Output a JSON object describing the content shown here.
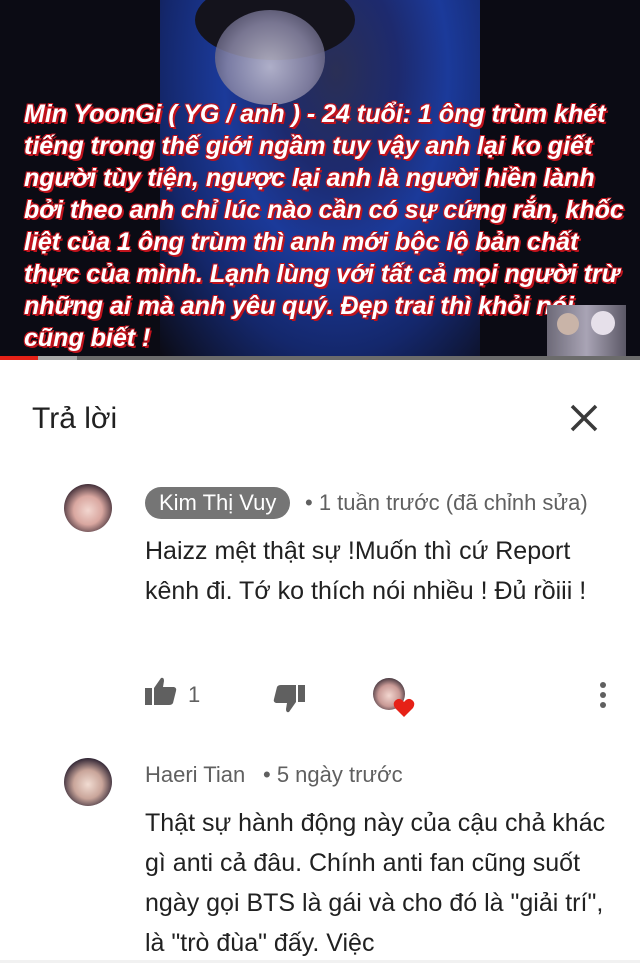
{
  "video": {
    "caption": "Min YoonGi ( YG / anh ) - 24 tuổi: 1 ông trùm khét tiếng trong thế giới ngầm tuy vậy anh lại ko giết người tùy tiện, ngược lại anh là người hiền lành bởi theo anh chỉ lúc nào cần có sự cứng rắn, khốc liệt của 1 ông trùm thì anh mới bộc lộ bản chất thực của mình. Lạnh lùng với tất cả mọi người trừ những ai mà anh yêu quý. Đẹp trai thì khỏi nói cũng biết !",
    "progress_percent": 6,
    "buffered_percent": 12,
    "accent_color": "#e62117"
  },
  "header": {
    "title": "Trả lời",
    "close_icon": "close-icon"
  },
  "comments": [
    {
      "author": "Kim Thị Vuy",
      "time": "• 1 tuần trước (đã chỉnh sửa)",
      "text": "Haizz mệt thật sự !Muốn thì cứ Report kênh đi. Tớ ko thích nói nhiều ! Đủ rồiii !",
      "likes": "1",
      "like_icon": "thumbs-up-icon",
      "dislike_icon": "thumbs-down-icon",
      "heart_icon": "creator-heart-icon",
      "menu_icon": "more-vert-icon"
    },
    {
      "author": "Haeri Tian",
      "time": "• 5 ngày trước",
      "text": "Thật sự hành động này của cậu chả khác gì anti cả đâu. Chính anti fan cũng suốt ngày gọi BTS là gái và cho đó là \"giải trí\", là \"trò đùa\" đấy. Việc"
    }
  ]
}
